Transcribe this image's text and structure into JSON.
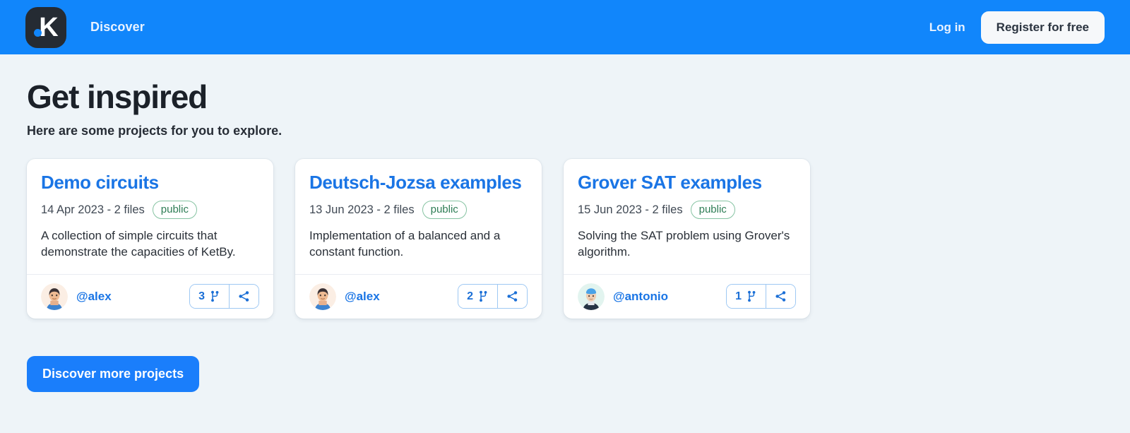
{
  "header": {
    "logo_letter": "K",
    "nav": [
      {
        "label": "Discover"
      }
    ],
    "login_label": "Log in",
    "register_label": "Register for free",
    "brand_color": "#1186fb"
  },
  "hero": {
    "title": "Get inspired",
    "subtitle": "Here are some projects for you to explore."
  },
  "cards": [
    {
      "title": "Demo circuits",
      "meta": "14 Apr 2023 - 2 files",
      "visibility": "public",
      "description": "A collection of simple circuits that demonstrate the capacities of KetBy.",
      "author": "@alex",
      "fork_count": "3",
      "avatar_style": "alex"
    },
    {
      "title": "Deutsch-Jozsa examples",
      "meta": "13 Jun 2023 - 2 files",
      "visibility": "public",
      "description": "Implementation of a balanced and a constant function.",
      "author": "@alex",
      "fork_count": "2",
      "avatar_style": "alex"
    },
    {
      "title": "Grover SAT examples",
      "meta": "15 Jun 2023 - 2 files",
      "visibility": "public",
      "description": "Solving the SAT problem using Grover's algorithm.",
      "author": "@antonio",
      "fork_count": "1",
      "avatar_style": "antonio"
    }
  ],
  "footer_cta": {
    "label": "Discover more projects"
  },
  "colors": {
    "accent_blue": "#1186fb",
    "link_blue": "#1a75e5",
    "badge_green": "#2e7d55",
    "page_bg": "#eef4f8"
  },
  "icons": {
    "fork": "fork-icon",
    "share": "share-icon"
  }
}
